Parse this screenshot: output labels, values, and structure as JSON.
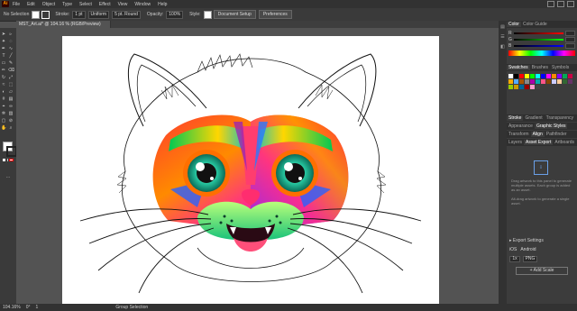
{
  "menu": [
    "File",
    "Edit",
    "Object",
    "Type",
    "Select",
    "Effect",
    "View",
    "Window",
    "Help"
  ],
  "app_logo": "Ai",
  "control": {
    "selection": "No Selection",
    "stroke_label": "Stroke:",
    "stroke_value": "1 pt",
    "uniform": "Uniform",
    "brush": "5 pt. Round",
    "opacity_label": "Opacity:",
    "opacity_value": "100%",
    "style_label": "Style:",
    "doc_setup": "Document Setup",
    "preferences": "Preferences"
  },
  "document_tab": "MST_Art.ai* @ 104.16 % (RGB/Preview)",
  "panels": {
    "color_tab": "Color",
    "color_guide_tab": "Color Guide",
    "channels": [
      "R",
      "G",
      "B"
    ],
    "swatches_tabs": [
      "Swatches",
      "Brushes",
      "Symbols"
    ],
    "stroke_tabs": [
      "Stroke",
      "Gradient",
      "Transparency"
    ],
    "appearance_tabs": [
      "Appearance",
      "Graphic Styles"
    ],
    "transform_tabs": [
      "Transform",
      "Align",
      "Pathfinder"
    ],
    "layers_tabs": [
      "Layers",
      "Asset Export",
      "Artboards"
    ],
    "asset_text1": "Drag artwork to this panel to generate multiple assets. Each group is added as an asset.",
    "asset_text2": "Alt-drag artwork to generate a single asset.",
    "export_settings": "Export Settings",
    "scale": "1x",
    "format": "PNG",
    "ios": "iOS",
    "android": "Android",
    "add_scale": "Add Scale"
  },
  "status": {
    "zoom": "104.16%",
    "angle": "0°",
    "artboard": "1",
    "mode": "Group Selection"
  },
  "colors": {
    "swatches": [
      "#ffffff",
      "#000000",
      "#ff0000",
      "#ffff00",
      "#00ff00",
      "#00ffff",
      "#0000ff",
      "#ff00ff",
      "#ff8800",
      "#8800ff",
      "#00aa55",
      "#cc0044",
      "#ffaa00",
      "#55aaff",
      "#aa5500",
      "#888888",
      "#aa00aa",
      "#00aaaa",
      "#ff5588",
      "#884400",
      "#ccccff",
      "#ffcc99",
      "#336633",
      "#663366",
      "#99cc00",
      "#cc9900",
      "#006699",
      "#990000",
      "#ff99cc",
      "#444444"
    ]
  }
}
